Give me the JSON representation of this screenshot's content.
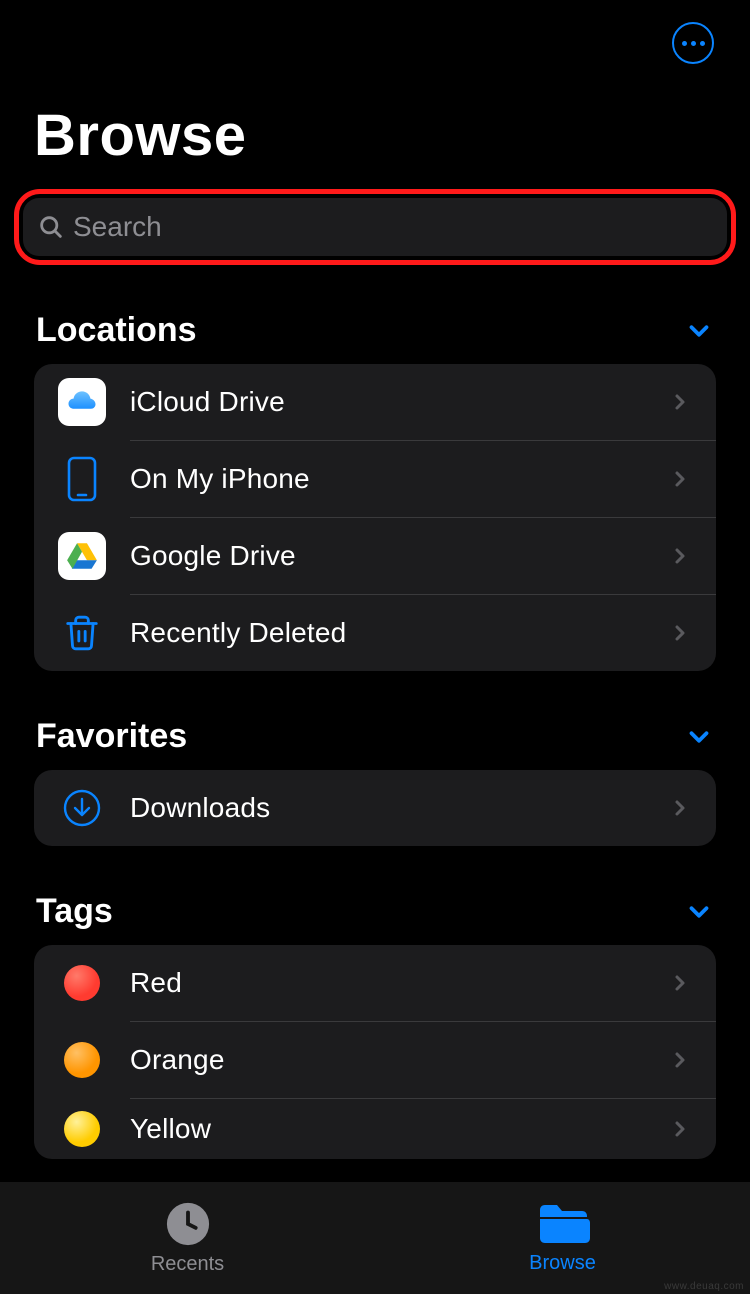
{
  "header": {
    "title": "Browse"
  },
  "search": {
    "placeholder": "Search"
  },
  "sections": {
    "locations": {
      "title": "Locations",
      "items": [
        {
          "label": "iCloud Drive",
          "icon": "icloud-icon"
        },
        {
          "label": "On My iPhone",
          "icon": "iphone-icon"
        },
        {
          "label": "Google Drive",
          "icon": "google-drive-icon"
        },
        {
          "label": "Recently Deleted",
          "icon": "trash-icon"
        }
      ]
    },
    "favorites": {
      "title": "Favorites",
      "items": [
        {
          "label": "Downloads",
          "icon": "downloads-icon"
        }
      ]
    },
    "tags": {
      "title": "Tags",
      "items": [
        {
          "label": "Red",
          "color": "#ff3b30"
        },
        {
          "label": "Orange",
          "color": "#ff9500"
        },
        {
          "label": "Yellow",
          "color": "#ffcc00"
        }
      ]
    }
  },
  "tabbar": {
    "recents": "Recents",
    "browse": "Browse",
    "active": "browse"
  },
  "accent_color": "#0a84ff"
}
